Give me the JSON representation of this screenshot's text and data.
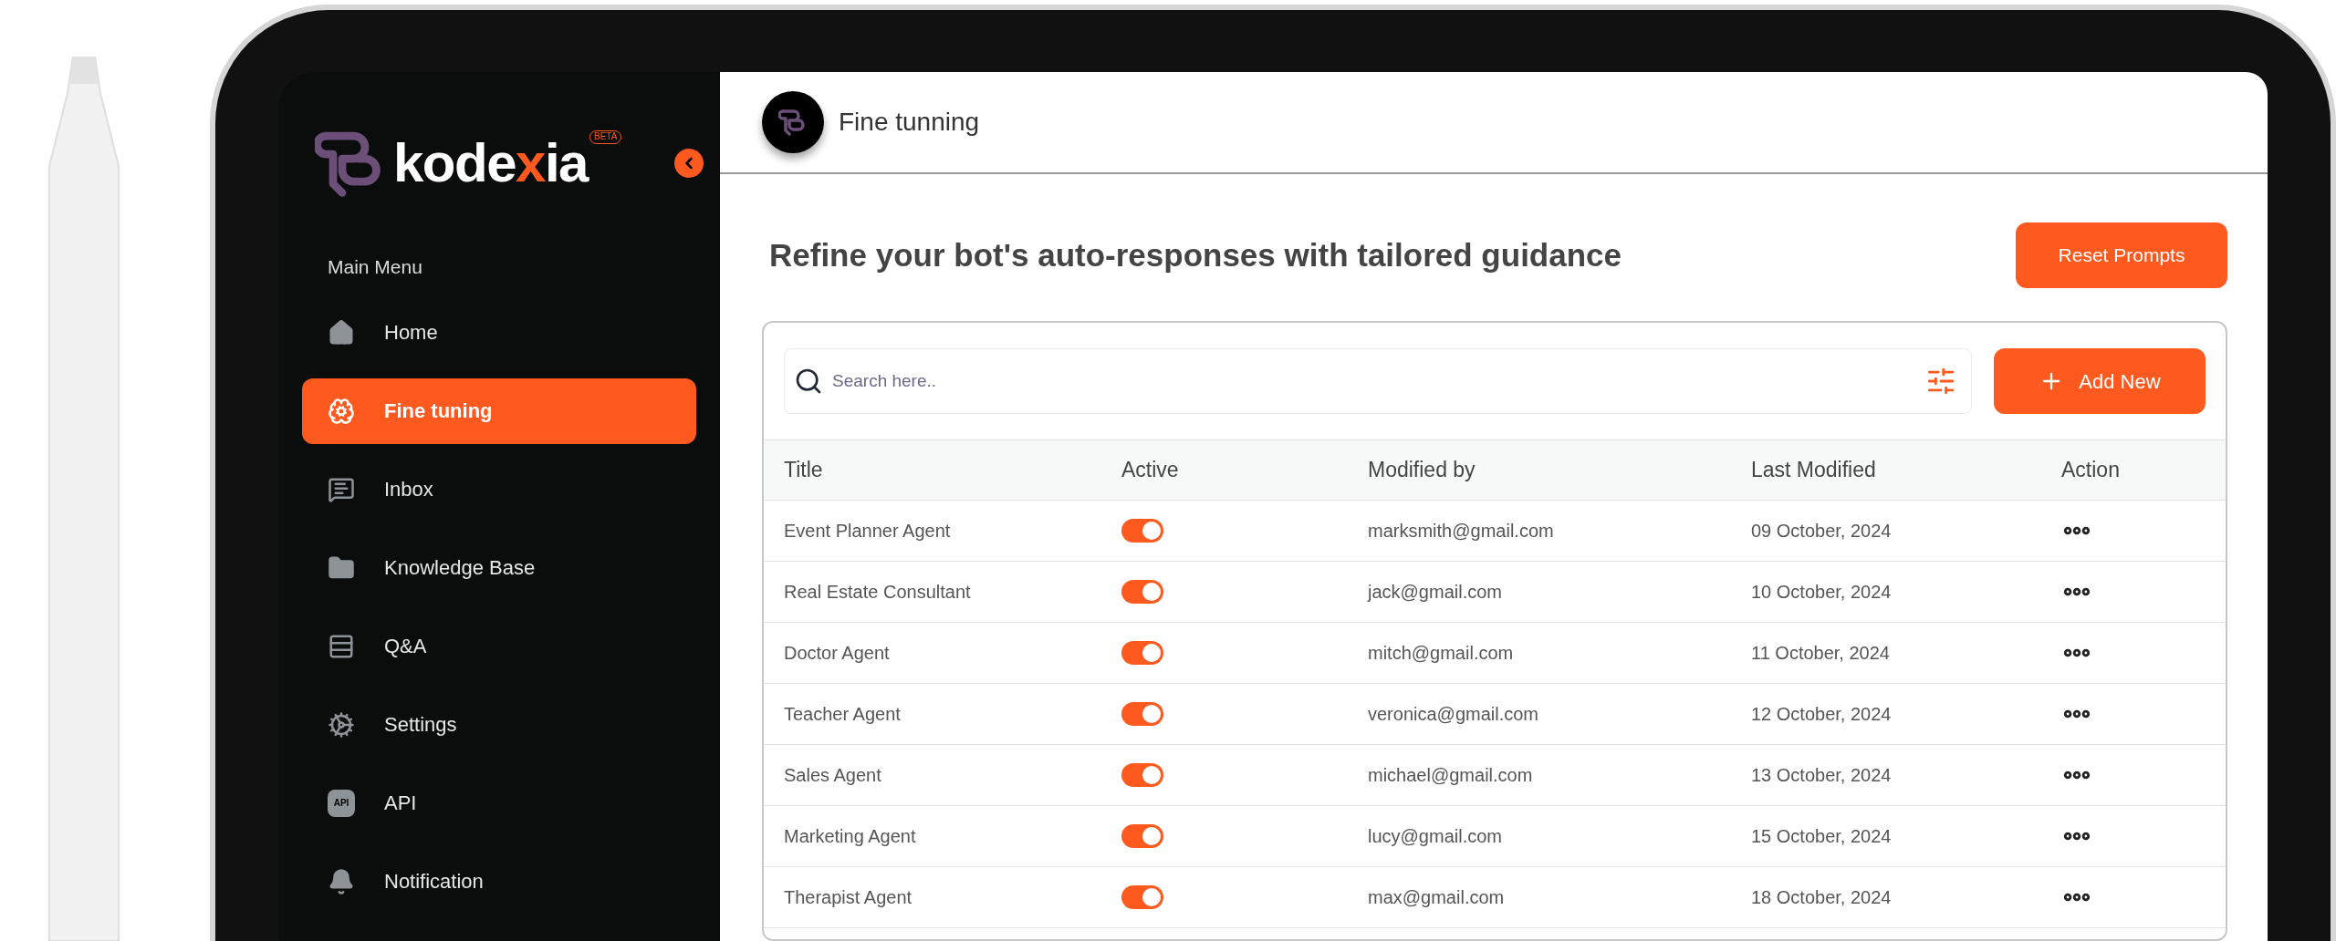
{
  "sidebar": {
    "logo": {
      "parts": [
        {
          "text": "kode",
          "accent": false
        },
        {
          "text": "x",
          "accent": true
        },
        {
          "text": "ia",
          "accent": false
        }
      ],
      "badge": "BETA"
    },
    "section": "Main Menu",
    "items": [
      {
        "label": "Home",
        "selected": false
      },
      {
        "label": "Fine tuning",
        "selected": true
      },
      {
        "label": "Inbox",
        "selected": false
      },
      {
        "label": "Knowledge Base",
        "selected": false
      },
      {
        "label": "Q&A",
        "selected": false
      },
      {
        "label": "Settings",
        "selected": false
      },
      {
        "label": "API",
        "icon_text": "API",
        "selected": false
      },
      {
        "label": "Notification",
        "selected": false
      }
    ]
  },
  "header": {
    "title": "Fine tunning"
  },
  "page": {
    "heading": "Refine your bot's auto-responses with tailored guidance",
    "reset_button": "Reset Prompts"
  },
  "search": {
    "placeholder": "Search here.."
  },
  "add_button": "Add New",
  "table": {
    "columns": [
      "Title",
      "Active",
      "Modified by",
      "Last Modified",
      "Action"
    ],
    "rows": [
      {
        "title": "Event Planner Agent",
        "active": true,
        "modified_by": "marksmith@gmail.com",
        "last_modified": "09 October, 2024"
      },
      {
        "title": "Real Estate Consultant",
        "active": true,
        "modified_by": "jack@gmail.com",
        "last_modified": "10 October, 2024"
      },
      {
        "title": "Doctor Agent",
        "active": true,
        "modified_by": "mitch@gmail.com",
        "last_modified": "11 October, 2024"
      },
      {
        "title": "Teacher Agent",
        "active": true,
        "modified_by": "veronica@gmail.com",
        "last_modified": "12 October, 2024"
      },
      {
        "title": "Sales Agent",
        "active": true,
        "modified_by": "michael@gmail.com",
        "last_modified": "13 October, 2024"
      },
      {
        "title": "Marketing Agent",
        "active": true,
        "modified_by": "lucy@gmail.com",
        "last_modified": "15 October, 2024"
      },
      {
        "title": "Therapist Agent",
        "active": true,
        "modified_by": "max@gmail.com",
        "last_modified": "18 October, 2024"
      }
    ]
  }
}
